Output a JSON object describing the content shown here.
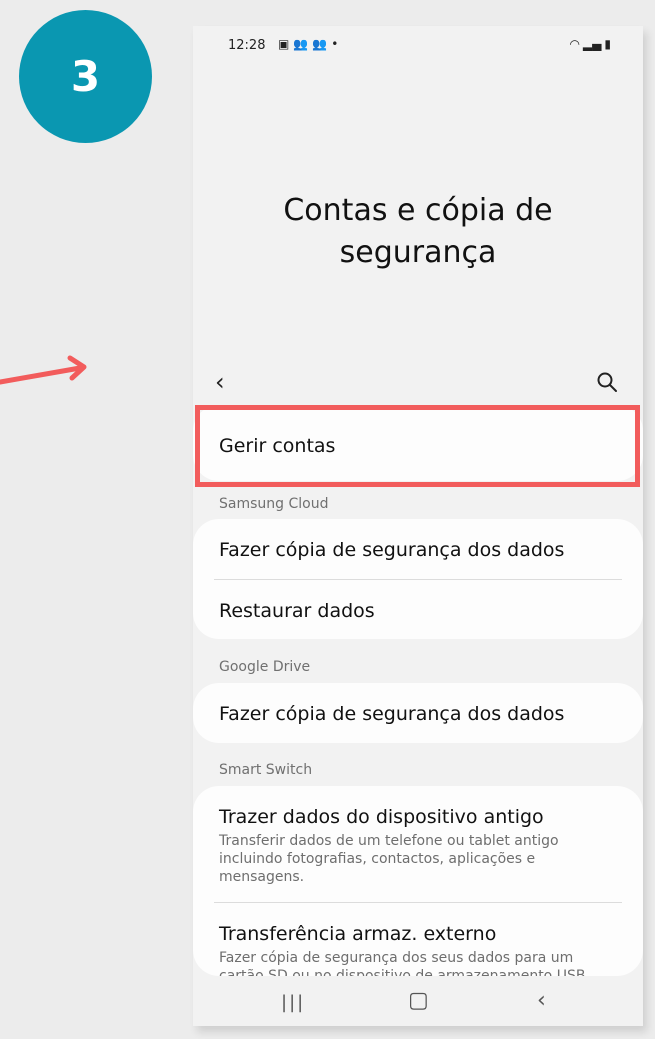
{
  "step": {
    "number": "3"
  },
  "status_bar": {
    "time": "12:28",
    "icons": [
      "image-icon",
      "people-icon",
      "people-icon",
      "dot-icon"
    ],
    "right_icons": [
      "wifi-icon",
      "signal-icon",
      "battery-icon"
    ]
  },
  "title": {
    "line1": "Contas e cópia de",
    "line2": "segurança"
  },
  "toolbar": {
    "back_icon": "chevron-left-icon",
    "search_icon": "search-icon"
  },
  "items": {
    "manage_accounts": "Gerir contas",
    "samsung_cloud_label": "Samsung Cloud",
    "samsung_backup": "Fazer cópia de segurança dos dados",
    "samsung_restore": "Restaurar dados",
    "google_drive_label": "Google Drive",
    "google_backup": "Fazer cópia de segurança dos dados",
    "smart_switch_label": "Smart Switch",
    "bring_data_title": "Trazer dados do dispositivo antigo",
    "bring_data_sub": "Transferir dados de um telefone ou tablet antigo incluindo fotografias, contactos, aplicações e mensagens.",
    "external_title": "Transferência armaz. externo",
    "external_sub": "Fazer cópia de segurança dos seus dados para um cartão SD ou no dispositivo de armazenamento USB"
  },
  "navbar": {
    "recent": "recent-apps-icon",
    "home": "home-icon",
    "back": "back-icon"
  },
  "colors": {
    "badge": "#0a97b1",
    "highlight": "#f25c5c",
    "arrow": "#f25c5c"
  }
}
